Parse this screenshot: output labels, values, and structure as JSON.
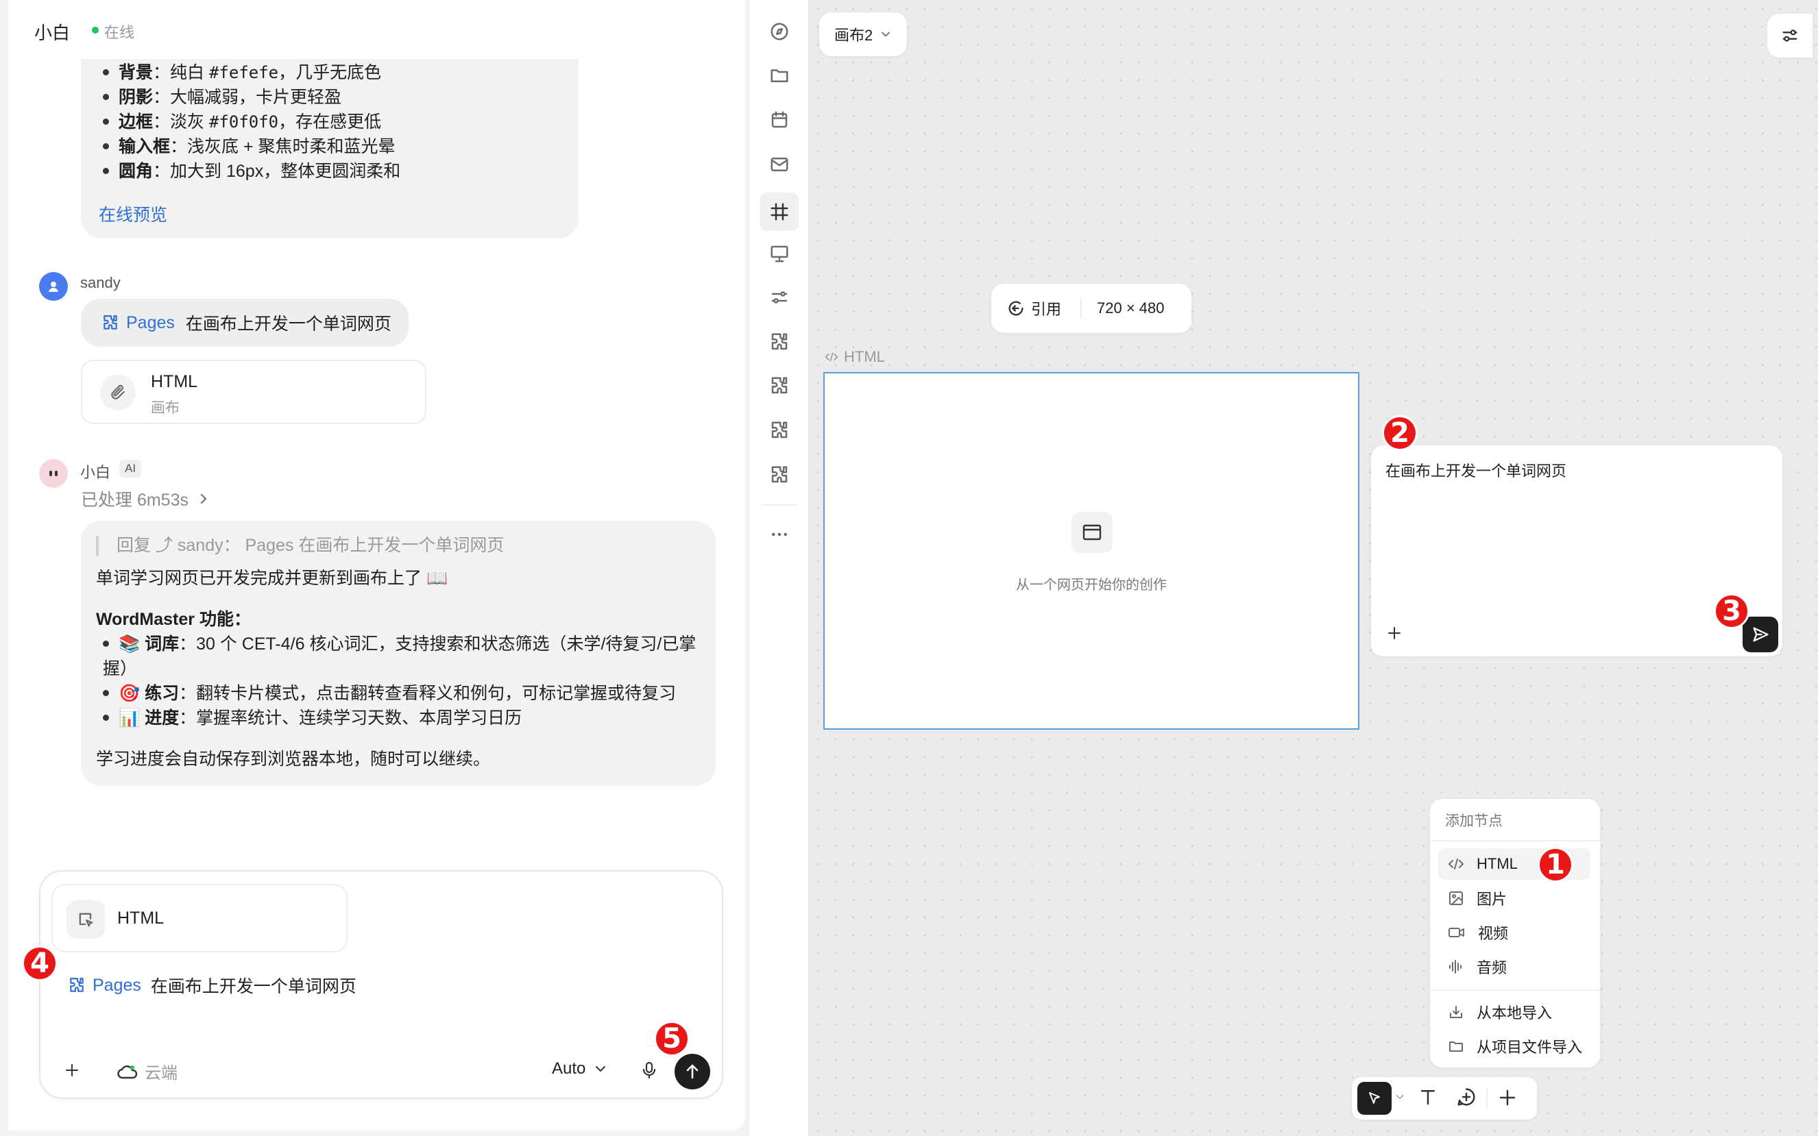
{
  "chat": {
    "header": {
      "name": "小白",
      "status": "在线"
    },
    "first_reply": {
      "items": [
        {
          "label": "背景",
          "colon": "：",
          "text_a": "纯白 ",
          "code": "#fefefe",
          "text_b": "，几乎无底色"
        },
        {
          "label": "阴影",
          "colon": "：",
          "text_a": "大幅减弱，卡片更轻盈",
          "code": "",
          "text_b": ""
        },
        {
          "label": "边框",
          "colon": "：",
          "text_a": "淡灰 ",
          "code": "#f0f0f0",
          "text_b": "，存在感更低"
        },
        {
          "label": "输入框",
          "colon": "：",
          "text_a": "浅灰底 + 聚焦时柔和蓝光晕",
          "code": "",
          "text_b": ""
        },
        {
          "label": "圆角",
          "colon": "：",
          "text_a": "加大到 16px，整体更圆润柔和",
          "code": "",
          "text_b": ""
        }
      ],
      "link": "在线预览"
    },
    "user_message": {
      "user": "sandy",
      "pages_tag": "Pages",
      "text": "在画布上开发一个单词网页",
      "attachment_title": "HTML",
      "attachment_subtitle": "画布"
    },
    "ai_message": {
      "name": "小白",
      "ai_badge": "AI",
      "processed": "已处理 6m53s",
      "quote": "回复 ⤴ sandy： Pages 在画布上开发一个单词网页",
      "intro": "单词学习网页已开发完成并更新到画布上了 📖",
      "heading": "WordMaster 功能：",
      "features": [
        {
          "emoji": "📚",
          "label": "词库",
          "text": "：30 个 CET-4/6 核心词汇，支持搜索和状态筛选（未学/待复习/已掌",
          "cont": "握）"
        },
        {
          "emoji": "🎯",
          "label": "练习",
          "text": "：翻转卡片模式，点击翻转查看释义和例句，可标记掌握或待复习",
          "cont": ""
        },
        {
          "emoji": "📊",
          "label": "进度",
          "text": "：掌握率统计、连续学习天数、本周学习日历",
          "cont": ""
        }
      ],
      "footer": "学习进度会自动保存到浏览器本地，随时可以继续。"
    },
    "composer": {
      "attachment": "HTML",
      "pages_tag": "Pages",
      "text": "在画布上开发一个单词网页",
      "cloud_label": "云端",
      "model": "Auto"
    }
  },
  "canvas": {
    "tab_label": "画布2",
    "toolbar": {
      "quote_label": "引用",
      "size": "720 × 480"
    },
    "node_label": "HTML",
    "node_placeholder": "从一个网页开始你的创作",
    "prompt_text": "在画布上开发一个单词网页",
    "add_node_menu": {
      "title": "添加节点",
      "items": [
        "HTML",
        "图片",
        "视频",
        "音频"
      ],
      "imports": [
        "从本地导入",
        "从项目文件导入"
      ]
    }
  },
  "badges": [
    "1",
    "2",
    "3",
    "4",
    "5"
  ],
  "colors": {
    "accent": "#2f6fd6",
    "selection": "#5b9ee8",
    "badge": "#e81818",
    "online": "#22c55e"
  }
}
